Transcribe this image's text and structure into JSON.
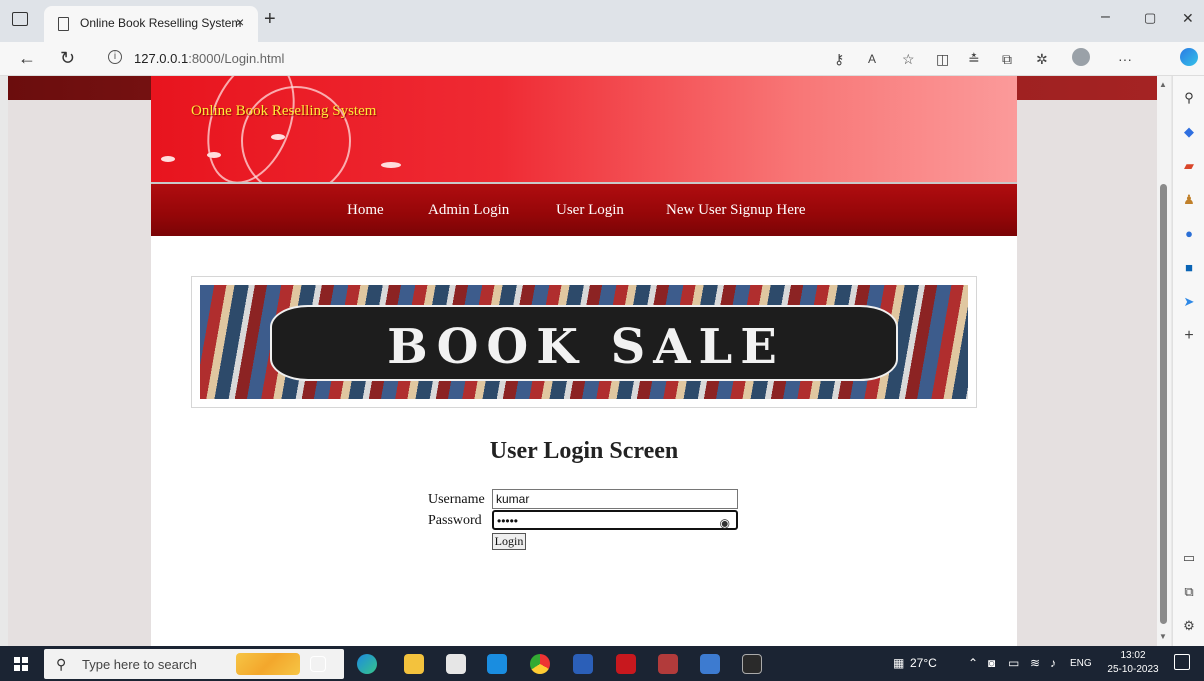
{
  "browser": {
    "tab_title": "Online Book Reselling System",
    "tab_close": "×",
    "new_tab": "+",
    "url_host": "127.0.0.1",
    "url_rest": ":8000/Login.html",
    "window_controls": {
      "minimize": "–",
      "restore": "▢",
      "close": "✕"
    }
  },
  "site": {
    "title": "Online Book Reselling System",
    "nav": [
      "Home",
      "Admin Login",
      "User Login",
      "New User Signup Here"
    ],
    "banner_text": "BOOK SALE"
  },
  "login": {
    "heading": "User Login Screen",
    "username_label": "Username",
    "username_value": "kumar",
    "password_label": "Password",
    "password_value": "•••••",
    "button": "Login"
  },
  "taskbar": {
    "search_placeholder": "Type here to search",
    "weather": "27°C",
    "language": "ENG",
    "time": "13:02",
    "date": "25-10-2023"
  },
  "colors": {
    "header_red": "#e8141e",
    "nav_dark_red": "#950608",
    "title_yellow": "#ffea3a",
    "taskbar": "#1b2433"
  },
  "icons": [
    "tab-actions-icon",
    "page-icon",
    "back-icon",
    "refresh-icon",
    "info-icon",
    "read-aloud-icon",
    "favorite-icon",
    "split-screen-icon",
    "favorites-icon",
    "collections-icon",
    "extensions-icon",
    "profile-icon",
    "more-icon",
    "copilot-icon",
    "eye-icon",
    "windows-start-icon",
    "search-icon"
  ]
}
